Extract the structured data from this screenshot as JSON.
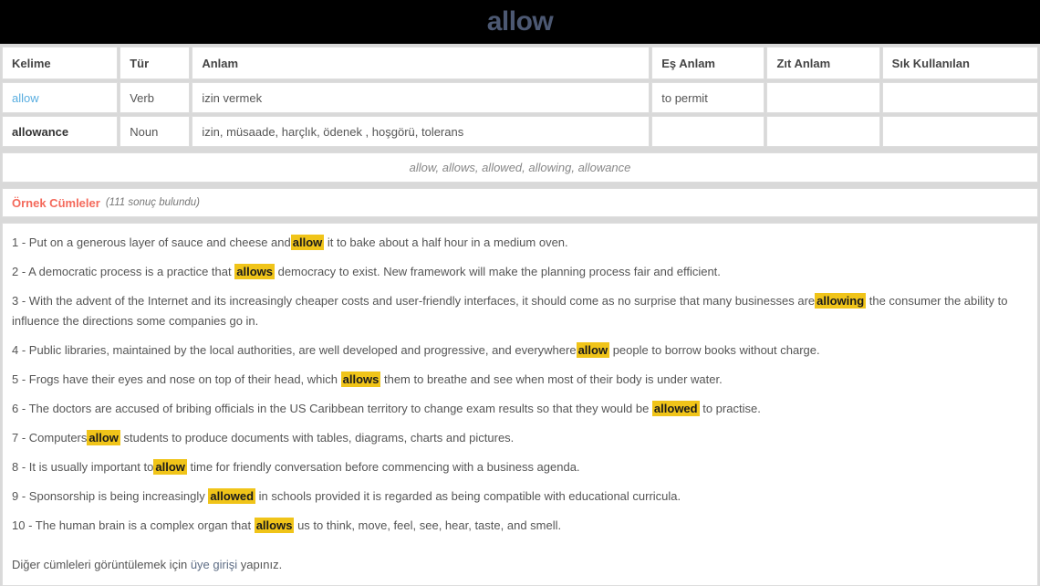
{
  "header": {
    "title": "allow",
    "title_color": "#4c5872",
    "background_color": "#000000"
  },
  "word_table": {
    "columns": [
      "Kelime",
      "Tür",
      "Anlam",
      "Eş Anlam",
      "Zıt Anlam",
      "Sık Kullanılan"
    ],
    "rows": [
      {
        "kelime": "allow",
        "kelime_is_link": true,
        "tur": "Verb",
        "anlam": "izin vermek",
        "es_anlam": "to permit",
        "zit_anlam": "",
        "sik_kullanilan": ""
      },
      {
        "kelime": "allowance",
        "kelime_is_link": false,
        "tur": "Noun",
        "anlam": "izin, müsaade, harçlık, ödenek , hoşgörü, tolerans",
        "es_anlam": "",
        "zit_anlam": "",
        "sik_kullanilan": ""
      }
    ]
  },
  "word_forms": {
    "text": "allow, allows, allowed, allowing, allowance"
  },
  "examples_header": {
    "title": "Örnek Cümleler",
    "count_text": "(111 sonuç bulundu)",
    "title_color": "#f4695b"
  },
  "sentences": [
    {
      "number": "1 - ",
      "parts": [
        {
          "text": "Put on a generous layer of sauce and cheese and",
          "highlight": false
        },
        {
          "text": "allow",
          "highlight": true
        },
        {
          "text": " it to bake about a half hour in a medium oven.",
          "highlight": false
        }
      ]
    },
    {
      "number": "2 - ",
      "parts": [
        {
          "text": "A democratic process is a practice that ",
          "highlight": false
        },
        {
          "text": "allows",
          "highlight": true
        },
        {
          "text": " democracy to exist. New framework will make the planning process fair and efficient.",
          "highlight": false
        }
      ]
    },
    {
      "number": "3 - ",
      "parts": [
        {
          "text": "With the advent of the Internet and its increasingly cheaper costs and user-friendly interfaces, it should come as no surprise that many businesses are",
          "highlight": false
        },
        {
          "text": "allowing",
          "highlight": true
        },
        {
          "text": " the consumer the ability to influence the directions some companies go in.",
          "highlight": false
        }
      ]
    },
    {
      "number": "4 - ",
      "parts": [
        {
          "text": "Public libraries, maintained by the local authorities, are well developed and progressive, and everywhere",
          "highlight": false
        },
        {
          "text": "allow",
          "highlight": true
        },
        {
          "text": " people to borrow books without charge.",
          "highlight": false
        }
      ]
    },
    {
      "number": "5 - ",
      "parts": [
        {
          "text": "Frogs have their eyes and nose on top of their head, which ",
          "highlight": false
        },
        {
          "text": "allows",
          "highlight": true
        },
        {
          "text": " them to breathe and see when most of their body is under water.",
          "highlight": false
        }
      ]
    },
    {
      "number": "6 - ",
      "parts": [
        {
          "text": "The doctors are accused of bribing officials in the US Caribbean territory to change exam results so that they would be ",
          "highlight": false
        },
        {
          "text": "allowed",
          "highlight": true
        },
        {
          "text": " to practise.",
          "highlight": false
        }
      ]
    },
    {
      "number": "7 - ",
      "parts": [
        {
          "text": "Computers",
          "highlight": false
        },
        {
          "text": "allow",
          "highlight": true
        },
        {
          "text": " students to produce documents with tables, diagrams, charts and pictures.",
          "highlight": false
        }
      ]
    },
    {
      "number": "8 - ",
      "parts": [
        {
          "text": "It is usually important to",
          "highlight": false
        },
        {
          "text": "allow",
          "highlight": true
        },
        {
          "text": " time for friendly conversation before commencing with a business agenda.",
          "highlight": false
        }
      ]
    },
    {
      "number": "9 - ",
      "parts": [
        {
          "text": "Sponsorship is being increasingly ",
          "highlight": false
        },
        {
          "text": "allowed",
          "highlight": true
        },
        {
          "text": " in schools provided it is regarded as being compatible with educational curricula.",
          "highlight": false
        }
      ]
    },
    {
      "number": "10 - ",
      "parts": [
        {
          "text": "The human brain is a complex organ that ",
          "highlight": false
        },
        {
          "text": "allows",
          "highlight": true
        },
        {
          "text": " us to think, move, feel, see, hear, taste, and smell.",
          "highlight": false
        }
      ]
    }
  ],
  "login_note": {
    "prefix": "Diğer cümleleri görüntülemek için ",
    "link_text": "üye girişi",
    "suffix": " yapınız."
  },
  "colors": {
    "highlight": "#f0c419",
    "word_link": "#5aaee0",
    "page_background": "#d9d9d9",
    "card_border": "#dddddd"
  }
}
